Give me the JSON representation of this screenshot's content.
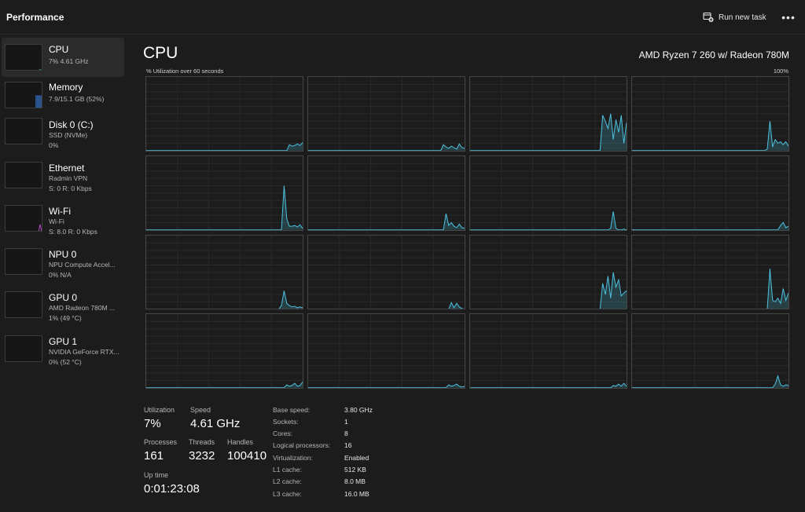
{
  "app": {
    "title": "Performance"
  },
  "toolbar": {
    "run_task_label": "Run new task",
    "more_label": "•••"
  },
  "sidebar": {
    "items": [
      {
        "name": "CPU",
        "line1": "7%  4.61 GHz",
        "line2": "",
        "selected": true,
        "level": 0.07,
        "color": "#4cc2e0"
      },
      {
        "name": "Memory",
        "line1": "7.9/15.1 GB (52%)",
        "line2": "",
        "selected": false,
        "level": 0.52,
        "color": "#3b7bdc"
      },
      {
        "name": "Disk 0 (C:)",
        "line1": "SSD (NVMe)",
        "line2": "0%",
        "selected": false,
        "level": 0.0,
        "color": "#6dbf4b"
      },
      {
        "name": "Ethernet",
        "line1": "Radmin VPN",
        "line2": "S: 0  R: 0 Kbps",
        "selected": false,
        "level": 0.0,
        "color": "#c58b3b"
      },
      {
        "name": "Wi-Fi",
        "line1": "Wi-Fi",
        "line2": "S: 8.0  R: 0 Kbps",
        "selected": false,
        "level": 0.3,
        "color": "#b04fc0"
      },
      {
        "name": "NPU 0",
        "line1": "NPU Compute Accel...",
        "line2": "0%  N/A",
        "selected": false,
        "level": 0.0,
        "color": "#4cc2e0"
      },
      {
        "name": "GPU 0",
        "line1": "AMD Radeon 780M ...",
        "line2": "1%  (49 °C)",
        "selected": false,
        "level": 0.02,
        "color": "#b04fc0"
      },
      {
        "name": "GPU 1",
        "line1": "NVIDIA GeForce RTX...",
        "line2": "0%  (52 °C)",
        "selected": false,
        "level": 0.0,
        "color": "#b04fc0"
      }
    ]
  },
  "main": {
    "title": "CPU",
    "model": "AMD Ryzen 7 260 w/ Radeon 780M",
    "util_label": "% Utilization over 60 seconds",
    "util_max": "100%",
    "graph_color": "#4cc2e0",
    "cores": [
      [
        0,
        0,
        0,
        0,
        0,
        0,
        0,
        0,
        0,
        0,
        0,
        0,
        0,
        0,
        0,
        0,
        0,
        0,
        0,
        0,
        0,
        0,
        0,
        0,
        0,
        0,
        0,
        0,
        0,
        0,
        0,
        0,
        0,
        0,
        0,
        0,
        0,
        0,
        0,
        0,
        0,
        0,
        0,
        0,
        0,
        0,
        0,
        0,
        0,
        0,
        0,
        0,
        0,
        0,
        8,
        6,
        7,
        9,
        7,
        11
      ],
      [
        0,
        0,
        0,
        0,
        0,
        0,
        0,
        0,
        0,
        0,
        0,
        0,
        0,
        0,
        0,
        0,
        0,
        0,
        0,
        0,
        0,
        0,
        0,
        0,
        0,
        0,
        0,
        0,
        0,
        0,
        0,
        0,
        0,
        0,
        0,
        0,
        0,
        0,
        0,
        0,
        0,
        0,
        0,
        0,
        0,
        0,
        0,
        0,
        0,
        0,
        0,
        8,
        5,
        3,
        6,
        4,
        2,
        9,
        4,
        3
      ],
      [
        0,
        0,
        0,
        0,
        0,
        0,
        0,
        0,
        0,
        0,
        0,
        0,
        0,
        0,
        0,
        0,
        0,
        0,
        0,
        0,
        0,
        0,
        0,
        0,
        0,
        0,
        0,
        0,
        0,
        0,
        0,
        0,
        0,
        0,
        0,
        0,
        0,
        0,
        0,
        0,
        0,
        0,
        0,
        0,
        0,
        0,
        0,
        0,
        0,
        0,
        48,
        40,
        30,
        50,
        15,
        42,
        25,
        48,
        10,
        38
      ],
      [
        0,
        0,
        0,
        0,
        0,
        0,
        0,
        0,
        0,
        0,
        0,
        0,
        0,
        0,
        0,
        0,
        0,
        0,
        0,
        0,
        0,
        0,
        0,
        0,
        0,
        0,
        0,
        0,
        0,
        0,
        0,
        0,
        0,
        0,
        0,
        0,
        0,
        0,
        0,
        0,
        0,
        0,
        0,
        0,
        0,
        0,
        0,
        0,
        0,
        0,
        0,
        2,
        40,
        5,
        15,
        10,
        12,
        8,
        12,
        6
      ],
      [
        0,
        0,
        0,
        0,
        0,
        0,
        0,
        0,
        0,
        0,
        0,
        0,
        0,
        0,
        0,
        0,
        0,
        0,
        0,
        0,
        0,
        0,
        0,
        0,
        0,
        0,
        0,
        0,
        0,
        0,
        0,
        0,
        0,
        0,
        0,
        0,
        0,
        0,
        0,
        0,
        0,
        0,
        0,
        0,
        0,
        0,
        0,
        0,
        0,
        0,
        0,
        0,
        60,
        15,
        5,
        5,
        6,
        4,
        7,
        2
      ],
      [
        0,
        0,
        0,
        0,
        0,
        0,
        0,
        0,
        0,
        0,
        0,
        0,
        0,
        0,
        0,
        0,
        0,
        0,
        0,
        0,
        0,
        0,
        0,
        0,
        0,
        0,
        0,
        0,
        0,
        0,
        0,
        0,
        0,
        0,
        0,
        0,
        0,
        0,
        0,
        0,
        0,
        0,
        0,
        0,
        0,
        0,
        0,
        0,
        0,
        0,
        0,
        0,
        22,
        6,
        10,
        5,
        3,
        8,
        3,
        2
      ],
      [
        0,
        0,
        0,
        0,
        0,
        0,
        0,
        0,
        0,
        0,
        0,
        0,
        0,
        0,
        0,
        0,
        0,
        0,
        0,
        0,
        0,
        0,
        0,
        0,
        0,
        0,
        0,
        0,
        0,
        0,
        0,
        0,
        0,
        0,
        0,
        0,
        0,
        0,
        0,
        0,
        0,
        0,
        0,
        0,
        0,
        0,
        0,
        0,
        0,
        0,
        0,
        0,
        0,
        2,
        25,
        2,
        0,
        0,
        1,
        0
      ],
      [
        0,
        0,
        0,
        0,
        0,
        0,
        0,
        0,
        0,
        0,
        0,
        0,
        0,
        0,
        0,
        0,
        0,
        0,
        0,
        0,
        0,
        0,
        0,
        0,
        0,
        0,
        0,
        0,
        0,
        0,
        0,
        0,
        0,
        0,
        0,
        0,
        0,
        0,
        0,
        0,
        0,
        0,
        0,
        0,
        0,
        0,
        0,
        0,
        0,
        0,
        0,
        0,
        0,
        0,
        0,
        0,
        6,
        10,
        3,
        5
      ],
      [
        0,
        0,
        0,
        0,
        0,
        0,
        0,
        0,
        0,
        0,
        0,
        0,
        0,
        0,
        0,
        0,
        0,
        0,
        0,
        0,
        0,
        0,
        0,
        0,
        0,
        0,
        0,
        0,
        0,
        0,
        0,
        0,
        0,
        0,
        0,
        0,
        0,
        0,
        0,
        0,
        0,
        0,
        0,
        0,
        0,
        0,
        0,
        0,
        0,
        0,
        0,
        5,
        25,
        8,
        5,
        3,
        4,
        2,
        3,
        2
      ],
      [
        0,
        0,
        0,
        0,
        0,
        0,
        0,
        0,
        0,
        0,
        0,
        0,
        0,
        0,
        0,
        0,
        0,
        0,
        0,
        0,
        0,
        0,
        0,
        0,
        0,
        0,
        0,
        0,
        0,
        0,
        0,
        0,
        0,
        0,
        0,
        0,
        0,
        0,
        0,
        0,
        0,
        0,
        0,
        0,
        0,
        0,
        0,
        0,
        0,
        0,
        0,
        0,
        0,
        0,
        9,
        2,
        8,
        3,
        1,
        0
      ],
      [
        0,
        0,
        0,
        0,
        0,
        0,
        0,
        0,
        0,
        0,
        0,
        0,
        0,
        0,
        0,
        0,
        0,
        0,
        0,
        0,
        0,
        0,
        0,
        0,
        0,
        0,
        0,
        0,
        0,
        0,
        0,
        0,
        0,
        0,
        0,
        0,
        0,
        0,
        0,
        0,
        0,
        0,
        0,
        0,
        0,
        0,
        0,
        0,
        0,
        0,
        35,
        20,
        45,
        15,
        50,
        30,
        40,
        18,
        22,
        25
      ],
      [
        0,
        0,
        0,
        0,
        0,
        0,
        0,
        0,
        0,
        0,
        0,
        0,
        0,
        0,
        0,
        0,
        0,
        0,
        0,
        0,
        0,
        0,
        0,
        0,
        0,
        0,
        0,
        0,
        0,
        0,
        0,
        0,
        0,
        0,
        0,
        0,
        0,
        0,
        0,
        0,
        0,
        0,
        0,
        0,
        0,
        0,
        0,
        0,
        0,
        0,
        0,
        0,
        55,
        12,
        10,
        15,
        8,
        28,
        12,
        22
      ],
      [
        0,
        0,
        0,
        0,
        0,
        0,
        0,
        0,
        0,
        0,
        0,
        0,
        0,
        0,
        0,
        0,
        0,
        0,
        0,
        0,
        0,
        0,
        0,
        0,
        0,
        0,
        0,
        0,
        0,
        0,
        0,
        0,
        0,
        0,
        0,
        0,
        0,
        0,
        0,
        0,
        0,
        0,
        0,
        0,
        0,
        0,
        0,
        0,
        0,
        0,
        0,
        0,
        0,
        4,
        2,
        3,
        6,
        2,
        3,
        8
      ],
      [
        0,
        0,
        0,
        0,
        0,
        0,
        0,
        0,
        0,
        0,
        0,
        0,
        0,
        0,
        0,
        0,
        0,
        0,
        0,
        0,
        0,
        0,
        0,
        0,
        0,
        0,
        0,
        0,
        0,
        0,
        0,
        0,
        0,
        0,
        0,
        0,
        0,
        0,
        0,
        0,
        0,
        0,
        0,
        0,
        0,
        0,
        0,
        0,
        0,
        0,
        0,
        0,
        0,
        4,
        2,
        3,
        5,
        2,
        1,
        2
      ],
      [
        0,
        0,
        0,
        0,
        0,
        0,
        0,
        0,
        0,
        0,
        0,
        0,
        0,
        0,
        0,
        0,
        0,
        0,
        0,
        0,
        0,
        0,
        0,
        0,
        0,
        0,
        0,
        0,
        0,
        0,
        0,
        0,
        0,
        0,
        0,
        0,
        0,
        0,
        0,
        0,
        0,
        0,
        0,
        0,
        0,
        0,
        0,
        0,
        0,
        0,
        0,
        0,
        0,
        0,
        3,
        2,
        5,
        2,
        6,
        2
      ],
      [
        0,
        0,
        0,
        0,
        0,
        0,
        0,
        0,
        0,
        0,
        0,
        0,
        0,
        0,
        0,
        0,
        0,
        0,
        0,
        0,
        0,
        0,
        0,
        0,
        0,
        0,
        0,
        0,
        0,
        0,
        0,
        0,
        0,
        0,
        0,
        0,
        0,
        0,
        0,
        0,
        0,
        0,
        0,
        0,
        0,
        0,
        0,
        0,
        0,
        0,
        0,
        0,
        0,
        0,
        5,
        16,
        4,
        2,
        4,
        3
      ]
    ]
  },
  "stats": {
    "utilization_label": "Utilization",
    "utilization": "7%",
    "speed_label": "Speed",
    "speed": "4.61 GHz",
    "processes_label": "Processes",
    "processes": "161",
    "threads_label": "Threads",
    "threads": "3232",
    "handles_label": "Handles",
    "handles": "100410",
    "uptime_label": "Up time",
    "uptime": "0:01:23:08"
  },
  "specs": [
    {
      "label": "Base speed:",
      "value": "3.80 GHz"
    },
    {
      "label": "Sockets:",
      "value": "1"
    },
    {
      "label": "Cores:",
      "value": "8"
    },
    {
      "label": "Logical processors:",
      "value": "16"
    },
    {
      "label": "Virtualization:",
      "value": "Enabled"
    },
    {
      "label": "L1 cache:",
      "value": "512 KB"
    },
    {
      "label": "L2 cache:",
      "value": "8.0 MB"
    },
    {
      "label": "L3 cache:",
      "value": "16.0 MB"
    }
  ]
}
